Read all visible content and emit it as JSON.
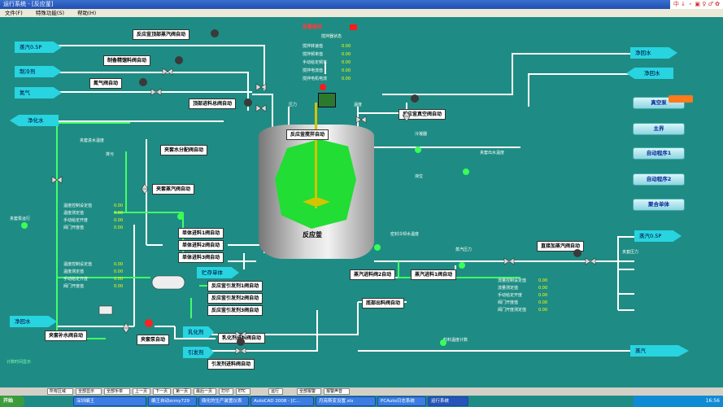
{
  "window": {
    "title": "运行系统 - [反应釜]",
    "ime_text": "中 ↓ ・ ▣ ♀ ♂ ✿"
  },
  "menu": [
    "文件(F)",
    "特殊功能(S)",
    "帮助(H)"
  ],
  "reactor": {
    "label": "反应釜",
    "agitator_label": "反应釜搅拌自动"
  },
  "labels": {
    "top_steam_valve": "反应釜顶部蒸汽阀自动",
    "water_main_valve": "制备精馏料阀自动",
    "n2_valve": "氮气阀自动",
    "top_feed_valve": "顶部进料总阀自动",
    "jacket_water_valve": "夹套水分配阀自动",
    "jacket_steam_valve": "夹套蒸汽阀自动",
    "unit1_valve": "单体进料1阀自动",
    "unit2_valve": "单体进料2阀自动",
    "unit3_valve": "单体进料3阀自动",
    "init1_valve": "反应釜引发剂1阀自动",
    "init2_valve": "反应釜引发剂2阀自动",
    "init3_valve": "反应釜引发剂3阀自动",
    "emulsifier_valve": "乳化剂进料阀自动",
    "initiator_feed_valve": "引发剂进料阀自动",
    "jacket_makeup_valve": "夹套补水阀自动",
    "jacket_pump": "夹套泵自动",
    "vacuum_valve": "反应釜真空阀自动",
    "steam_in2_valve": "蒸汽进料阀2自动",
    "steam_in1_valve": "蒸汽进料1阀自动",
    "bottom_discharge": "底部出料阀自动",
    "direct_steam_valve": "直接加蒸汽阀自动"
  },
  "left_arrows": {
    "steam": "蒸汽0.5P",
    "brine": "制冷剂",
    "n2": "氮气",
    "clean_water": "净化水",
    "top_water": "净回水"
  },
  "right_arrows": {
    "clean_water": "净回水",
    "return_water": "净回水",
    "vacuum": "真空泵",
    "steam_out": "蒸汽0.5P",
    "vapor": "蒸汽"
  },
  "right_buttons": [
    "真空泵",
    "主界",
    "自动程序1",
    "自动程序2",
    "聚合单体"
  ],
  "left_buttons": {
    "emulsifier": "乳化剂",
    "initiator": "引发剂",
    "storage": "贮存单体"
  },
  "alarm_text": "报警解除",
  "status_groups": {
    "top": {
      "title": "搅拌器状态",
      "rows": [
        "搅拌转速值",
        "搅拌频率值",
        "手动给定频率",
        "搅拌电流值",
        "搅拌电机电流"
      ],
      "values": [
        "0.00",
        "0.00",
        "0.00",
        "0.00",
        "0.00"
      ]
    },
    "left1": {
      "rows": [
        "温度控制设定值",
        "温度测定值",
        "手动给定开度",
        "阀门开度值"
      ],
      "values": [
        "0.00",
        "0.00",
        "0.00",
        "0.00"
      ]
    },
    "left2": {
      "rows": [
        "温度控制设定值",
        "温度测定值",
        "手动给定开度",
        "阀门开度值"
      ],
      "values": [
        "0.00",
        "0.00",
        "0.00",
        "0.00"
      ]
    },
    "right": {
      "rows": [
        "流量控制设定值",
        "流量测定值",
        "手动给定开度",
        "阀门开度值",
        "阀门开度测定值"
      ],
      "values": [
        "0.00",
        "0.00",
        "0.00",
        "0.00",
        "0.00"
      ]
    }
  },
  "misc_text": {
    "jacket_inlet_temp": "夹套进水温度",
    "drain": "排污",
    "reactor_press": "压力",
    "reactor_temp": "温度",
    "outlet_temp": "夹套出水温度",
    "condenser": "冷凝器",
    "seal_temp": "密封冷却水温度",
    "level": "液位",
    "pump_status": "夹套泵运行",
    "discharge_temp": "料料温度计数",
    "steam_press": "蒸汽压力",
    "jacket_press": "夹套压力",
    "time_readout": "计数时间显示"
  },
  "statusbar": [
    "所有区域",
    "全部显示",
    "全部手单",
    "上一页",
    "下一页",
    "第一页",
    "最后一页",
    "打印",
    "ETC",
    "运行",
    "全部报警",
    "报警声音"
  ],
  "taskbar": [
    "开始",
    "深圳编王",
    "编王自动zcmy729",
    "鼎化的生产装置仪表",
    "AutoCAD 2008 - [C...",
    "月亮斯变设置.xls",
    "PCAuto日志系统",
    "运行系统"
  ],
  "clock": "16:56"
}
